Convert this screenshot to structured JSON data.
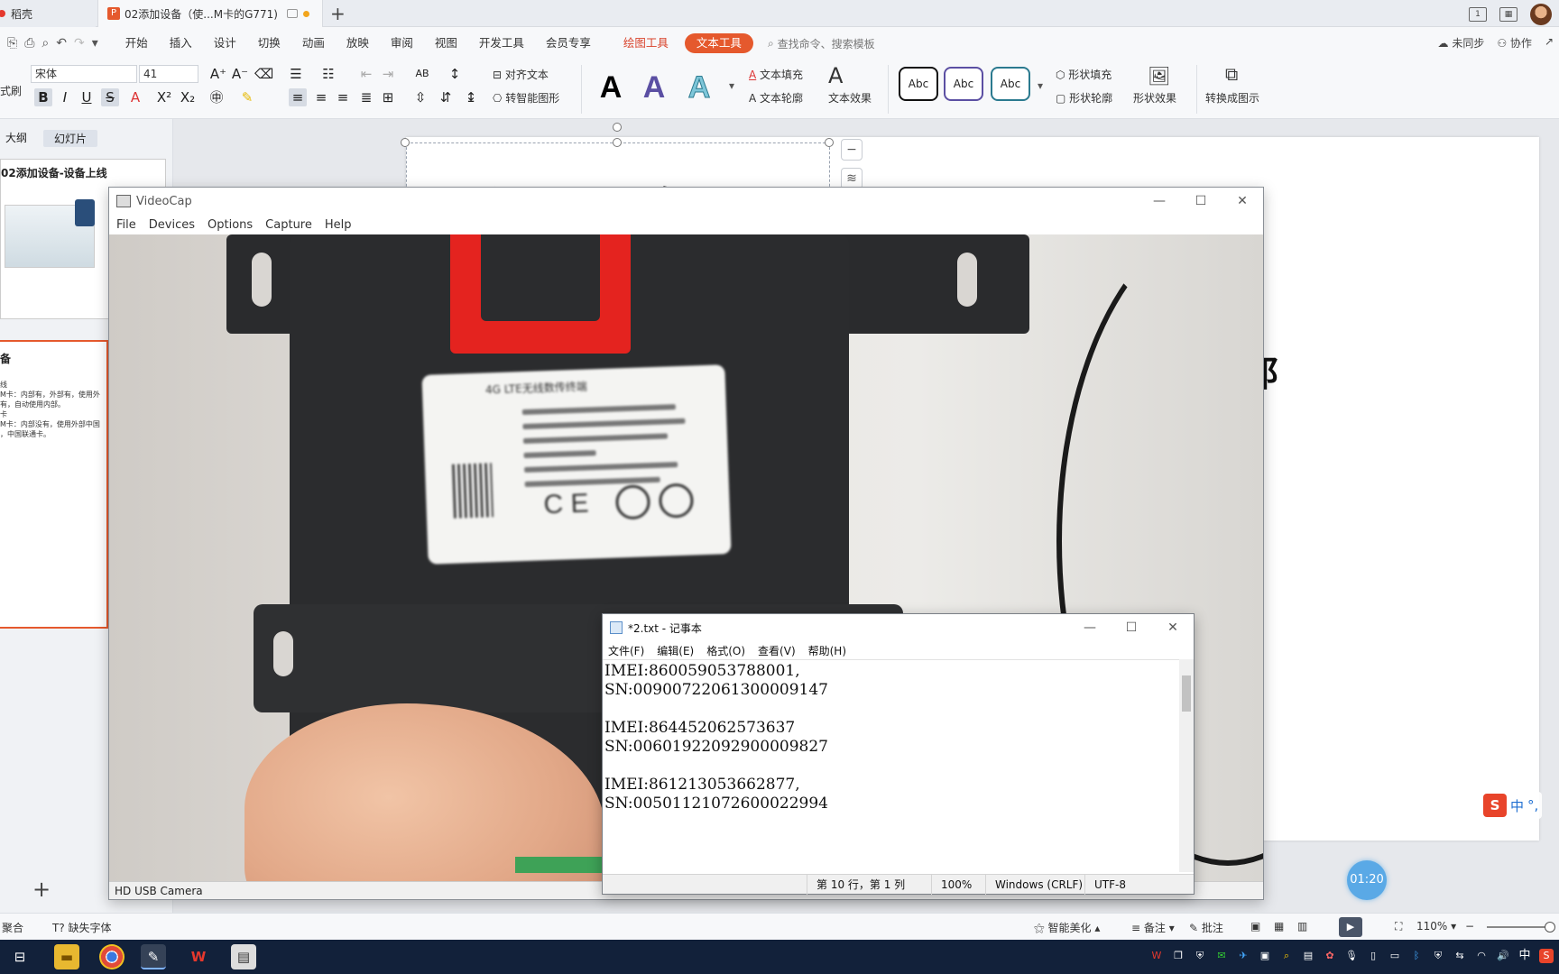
{
  "wps": {
    "home_tab": "稻壳",
    "doc_tab": "02添加设备（使...M卡的G771)",
    "new_tab": "+",
    "quick_access_icons": [
      "save-icon",
      "print-icon",
      "preview-icon",
      "undo-icon",
      "redo-icon",
      "more-icon"
    ],
    "menus": [
      "开始",
      "插入",
      "设计",
      "切换",
      "动画",
      "放映",
      "审阅",
      "视图",
      "开发工具",
      "会员专享"
    ],
    "menu_draw_tool": "绘图工具",
    "menu_text_tool": "文本工具",
    "search_cmd": "查找命令、搜索模板",
    "sync": "未同步",
    "collab": "协作",
    "ribbon": {
      "format_painter": "式刷",
      "font_name": "宋体",
      "font_size": "41",
      "align_text": "对齐文本",
      "smart_shape": "转智能图形",
      "text_fill": "文本填充",
      "text_outline": "文本轮廓",
      "text_effect": "文本效果",
      "shape_fill": "形状填充",
      "shape_outline": "形状轮廓",
      "shape_effect": "形状效果",
      "convert_diagram": "转换成图示",
      "style_sample": "Abc",
      "big_a": "A",
      "bold": "B",
      "italic": "I",
      "underline": "U",
      "strike": "S"
    },
    "left_panel": {
      "tab_outline": "大纲",
      "tab_slides": "幻灯片",
      "thumb1_title": "02添加设备-设备上线",
      "thumb2_head": "备",
      "thumb2_lines": [
        "线",
        "M卡：内部有，外部有，使用外",
        "有，自动使用内部。",
        "卡",
        "M卡：内部没有，使用外部中国",
        "，中国联通卡。"
      ]
    },
    "slide": {
      "title": "02添加设备",
      "side_char": "阝"
    },
    "timer": "01:20",
    "status": {
      "merge": "聚合",
      "missing_font": "缺失字体",
      "beautify": "智能美化",
      "notes": "备注",
      "comments": "批注",
      "zoom": "110%"
    },
    "ime_label": "中"
  },
  "videocap": {
    "title": "VideoCap",
    "menus": [
      "File",
      "Devices",
      "Options",
      "Capture",
      "Help"
    ],
    "status": "HD USB Camera",
    "label_title": "4G LTE无线数传终端"
  },
  "notepad": {
    "title": "*2.txt - 记事本",
    "menus": [
      "文件(F)",
      "编辑(E)",
      "格式(O)",
      "查看(V)",
      "帮助(H)"
    ],
    "content": "IMEI:860059053788001,\nSN:00900722061300009147\n\nIMEI:864452062573637\nSN:00601922092900009827\n\nIMEI:861213053662877,\nSN:00501121072600022994\n",
    "status_pos": "第 10 行，第 1 列",
    "status_zoom": "100%",
    "status_eol": "Windows (CRLF)",
    "status_enc": "UTF-8"
  },
  "taskbar": {
    "tray_lang": "中"
  }
}
